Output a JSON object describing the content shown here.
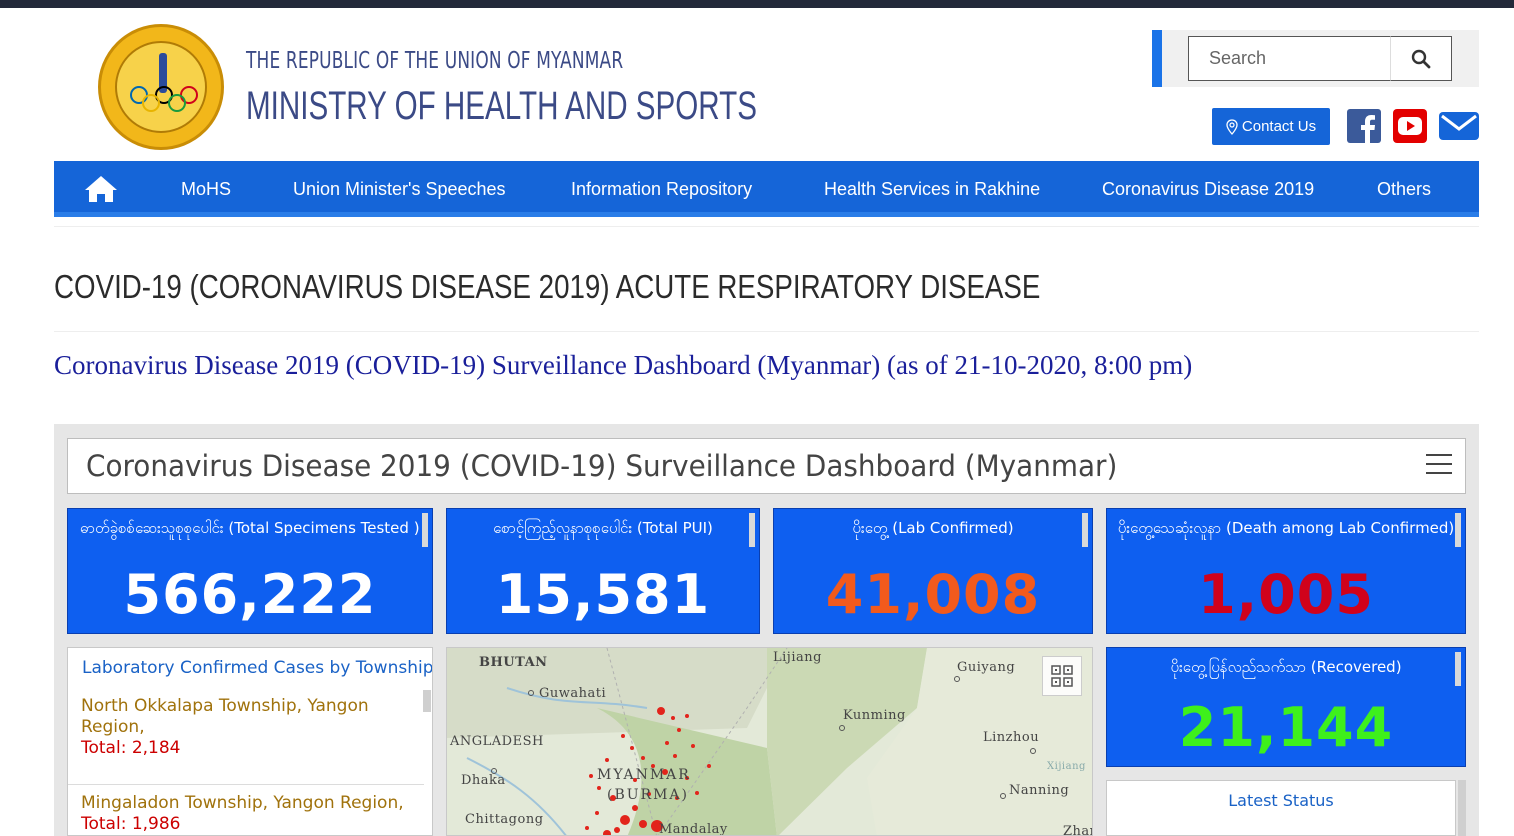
{
  "header": {
    "republic": "THE REPUBLIC OF THE UNION OF MYANMAR",
    "ministry": "MINISTRY OF HEALTH AND SPORTS",
    "logo_text": "MINISTRY OF HEALTH AND SPORTS"
  },
  "search": {
    "placeholder": "Search"
  },
  "contact": {
    "label": "Contact Us"
  },
  "nav": {
    "items": [
      "MoHS",
      "Union Minister's Speeches",
      "Information Repository",
      "Health Services in Rakhine",
      "Coronavirus Disease 2019",
      "Others"
    ]
  },
  "page": {
    "title": "COVID-19 (CORONAVIRUS DISEASE 2019) ACUTE RESPIRATORY DISEASE",
    "subtitle": "Coronavirus Disease 2019 (COVID-19) Surveillance Dashboard (Myanmar) (as of 21-10-2020, 8:00 pm)"
  },
  "dashboard": {
    "title": "Coronavirus Disease 2019 (COVID-19) Surveillance Dashboard (Myanmar)",
    "cards": [
      {
        "label": "ဓာတ်ခွဲစစ်ဆေးသူစုစုပေါင်း (Total Specimens Tested )",
        "value": "566,222",
        "color": "#ffffff"
      },
      {
        "label": "စောင့်ကြည့်လူနာစုစုပေါင်း (Total PUI)",
        "value": "15,581",
        "color": "#ffffff"
      },
      {
        "label": "ပိုးတွေ့ (Lab Confirmed)",
        "value": "41,008",
        "color": "#f25a1d"
      },
      {
        "label": "ပိုးတွေ့သေဆုံးလူနာ (Death among Lab Confirmed)",
        "value": "1,005",
        "color": "#d0021b"
      },
      {
        "label": "ပိုးတွေ့ပြန်လည်သက်သာ (Recovered)",
        "value": "21,144",
        "color": "#3ef01c"
      }
    ],
    "township_list": {
      "title": "Laboratory Confirmed Cases by Township",
      "items": [
        {
          "name": "North Okkalapa Township, Yangon Region,",
          "total": "Total: 2,184"
        },
        {
          "name": "Mingaladon Township, Yangon Region,",
          "total": "Total: 1,986"
        }
      ]
    },
    "map_labels": [
      "BHUTAN",
      "Guwahati",
      "ANGLADESH",
      "Dhaka",
      "Chittagong",
      "MYANMAR",
      "(BURMA)",
      "Mandalay",
      "Lijiang",
      "Kunming",
      "Guiyang",
      "Linzhou",
      "Nanning",
      "Xijiang",
      "Zhan"
    ],
    "latest_status": {
      "title": "Latest Status"
    }
  },
  "colors": {
    "nav_bg": "#1565d8",
    "card_bg": "#0e5ff0",
    "heading_blue": "#3b4a86",
    "subtitle_blue": "#1a1f9a"
  }
}
